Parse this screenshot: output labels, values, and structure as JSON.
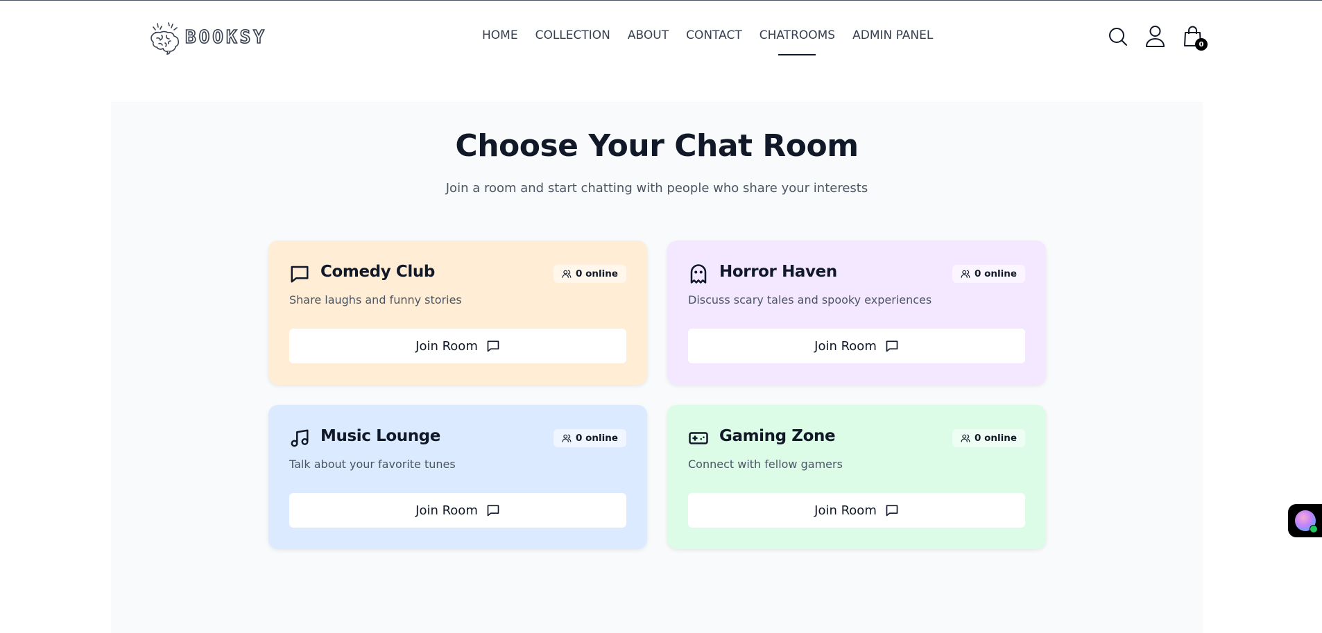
{
  "header": {
    "logo_text": "BOOKSY",
    "logo_icon": "brain-icon",
    "nav": [
      "HOME",
      "COLLECTION",
      "ABOUT",
      "CONTACT",
      "CHATROOMS",
      "ADMIN PANEL"
    ],
    "active_nav": "CHATROOMS",
    "icons": [
      "search-icon",
      "user-icon",
      "shopping-bag-icon"
    ],
    "cart_count": "0"
  },
  "main": {
    "title": "Choose Your Chat Room",
    "subtitle": "Join a room and start chatting with people who share your interests",
    "rooms": [
      {
        "name": "Comedy Club",
        "description": "Share laughs and funny stories",
        "online": "0 online",
        "button": "Join Room",
        "icon": "message-square-icon",
        "bg": "#ffedd5"
      },
      {
        "name": "Horror Haven",
        "description": "Discuss scary tales and spooky experiences",
        "online": "0 online",
        "button": "Join Room",
        "icon": "ghost-icon",
        "bg": "#f3e8ff"
      },
      {
        "name": "Music Lounge",
        "description": "Talk about your favorite tunes",
        "online": "0 online",
        "button": "Join Room",
        "icon": "music-icon",
        "bg": "#dbeafe"
      },
      {
        "name": "Gaming Zone",
        "description": "Connect with fellow gamers",
        "online": "0 online",
        "button": "Join Room",
        "icon": "gamepad-icon",
        "bg": "#dcfce7"
      }
    ]
  },
  "chat_widget": {
    "icon": "chat-avatar-icon",
    "status_color": "#22c55e"
  }
}
